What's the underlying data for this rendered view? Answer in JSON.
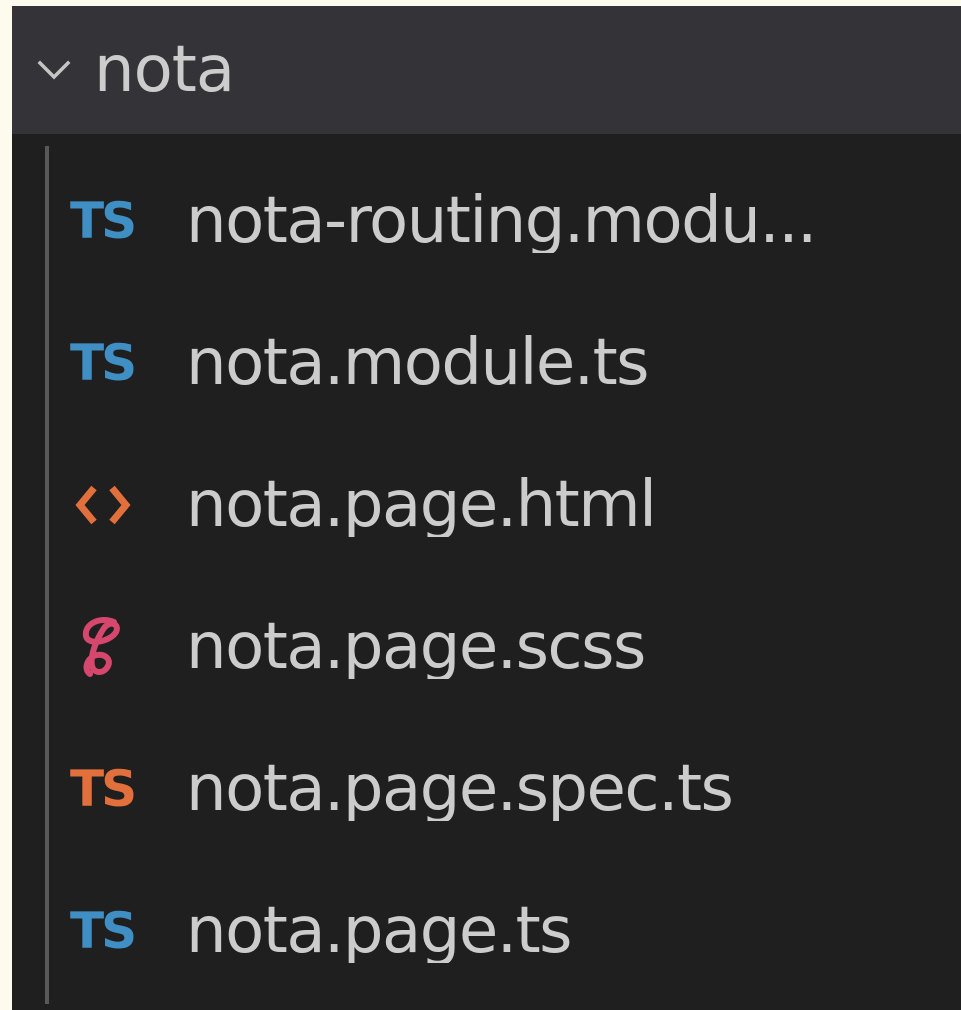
{
  "folder": {
    "name": "nota",
    "icon": "chevron-down-icon"
  },
  "colors": {
    "ts_blue": "#3f8fc4",
    "ts_orange": "#e2703c",
    "html_orange": "#e2703c",
    "scss_pink": "#d6476d"
  },
  "files": [
    {
      "name": "nota-routing.modu...",
      "icon": "typescript-icon",
      "icon_label": "TS"
    },
    {
      "name": "nota.module.ts",
      "icon": "typescript-icon",
      "icon_label": "TS"
    },
    {
      "name": "nota.page.html",
      "icon": "html-icon",
      "icon_label": ""
    },
    {
      "name": "nota.page.scss",
      "icon": "sass-icon",
      "icon_label": ""
    },
    {
      "name": "nota.page.spec.ts",
      "icon": "typescript-test-icon",
      "icon_label": "TS"
    },
    {
      "name": "nota.page.ts",
      "icon": "typescript-icon",
      "icon_label": "TS"
    }
  ]
}
